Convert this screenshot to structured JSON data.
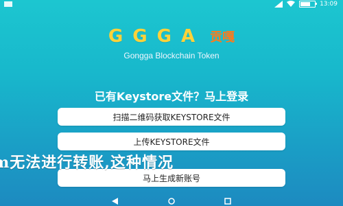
{
  "status_bar": {
    "time": "13:09",
    "icons": [
      "signal-icon",
      "wifi-icon",
      "battery-icon"
    ]
  },
  "logo": {
    "text": "GGGA",
    "badge": "贡嘎",
    "tagline": "Gongga Blockchain Token"
  },
  "login": {
    "title": "已有Keystore文件？马上登录"
  },
  "buttons": {
    "scan": "扫描二维码获取KEYSTORE文件",
    "upload": "上传KEYSTORE文件",
    "create": "马上生成新账号"
  },
  "overlay": {
    "text": "m无法进行转账,这种情况"
  },
  "nav": {
    "icons": [
      "back-icon",
      "home-icon",
      "recents-icon"
    ]
  },
  "colors": {
    "accent": "#ffd23a",
    "badge": "#ff7a1a",
    "bg_top": "#1cc6d0",
    "bg_bottom": "#1d8ac0"
  }
}
